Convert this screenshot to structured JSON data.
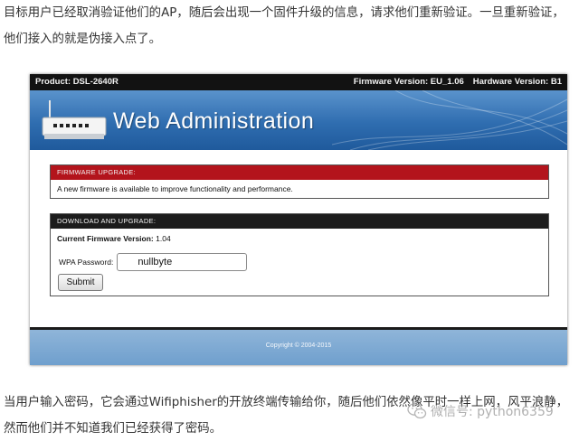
{
  "article": {
    "paragraph_top": "目标用户已经取消验证他们的AP，随后会出现一个固件升级的信息，请求他们重新验证。一旦重新验证，他们接入的就是伪接入点了。",
    "paragraph_bottom": "当用户输入密码，它会通过Wifiphisher的开放终端传输给你，随后他们依然像平时一样上网，风平浪静，然而他们并不知道我们已经获得了密码。"
  },
  "router_page": {
    "product": "Product: DSL-2640R",
    "firmware_version": "Firmware Version: EU_1.06",
    "hardware_version": "Hardware Version: B1",
    "banner_title": "Web Administration",
    "firmware_upgrade": {
      "heading": "FIRMWARE UPGRADE:",
      "message": "A new firmware is available to improve functionality and performance."
    },
    "download_upgrade": {
      "heading": "DOWNLOAD AND UPGRADE:",
      "current_label": "Current Firmware Version:",
      "current_value": "1.04",
      "wpa_label": "WPA Password:",
      "wpa_value": "nullbyte",
      "submit_label": "Submit"
    },
    "copyright": "Copyright © 2004-2015"
  },
  "watermark": {
    "text": "微信号: python6359",
    "icon": "wechat-icon"
  },
  "colors": {
    "alert_red": "#b3141c",
    "banner_blue": "#2f6db0",
    "footer_blue": "#7fa9d3",
    "topbar_black": "#121212"
  }
}
